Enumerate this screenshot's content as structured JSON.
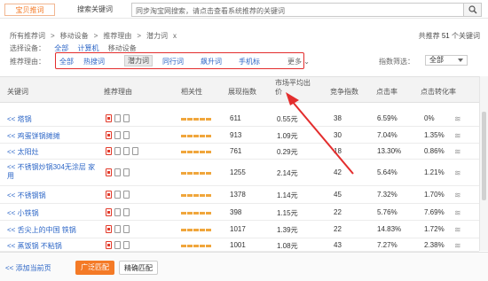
{
  "tabs": [
    {
      "label": "宝贝推词"
    },
    {
      "label": "搜索关键词"
    }
  ],
  "search": {
    "placeholder": "同步淘宝网搜索，请点击查看系统推荐的关键词"
  },
  "breadcrumb": {
    "a": "所有推荐词",
    "b": "移动设备",
    "c": "推荐理由",
    "d": "潜力词",
    "x": "x"
  },
  "count": {
    "prefix": "共推荐",
    "num": "51",
    "suffix": "个关键词"
  },
  "device": {
    "label": "选择设备：",
    "all": "全部",
    "pc": "计算机",
    "mobile": "移动设备"
  },
  "reason": {
    "label": "推荐理由：",
    "tags": [
      "全部",
      "热搜词",
      "潜力词",
      "同行词",
      "飙升词",
      "手机标"
    ],
    "more": "更多"
  },
  "filter": {
    "label": "指数筛选：",
    "value": "全部"
  },
  "columns": [
    "关键词",
    "推荐理由",
    "相关性",
    "展现指数",
    "市场平均出价",
    "竞争指数",
    "点击率",
    "点击转化率"
  ],
  "rows": [
    {
      "kw": "<< 塔锅",
      "show": "611",
      "price": "0.55元",
      "comp": "38",
      "ctr": "6.59%",
      "cvr": "0%"
    },
    {
      "kw": "<< 鸡蛋饼锅摊摊",
      "show": "913",
      "price": "1.09元",
      "comp": "30",
      "ctr": "7.04%",
      "cvr": "1.35%"
    },
    {
      "kw": "<< 太阳灶",
      "show": "761",
      "price": "0.29元",
      "comp": "18",
      "ctr": "13.30%",
      "cvr": "0.86%"
    },
    {
      "kw": "<< 不锈钢炒锅304无涂层 家用",
      "show": "1255",
      "price": "2.14元",
      "comp": "42",
      "ctr": "5.64%",
      "cvr": "1.21%"
    },
    {
      "kw": "<< 不锈钢锅",
      "show": "1378",
      "price": "1.14元",
      "comp": "45",
      "ctr": "7.32%",
      "cvr": "1.70%"
    },
    {
      "kw": "<< 小铁锅",
      "show": "398",
      "price": "1.15元",
      "comp": "22",
      "ctr": "5.76%",
      "cvr": "7.69%"
    },
    {
      "kw": "<< 舌尖上的中国 铁锅",
      "show": "1017",
      "price": "1.39元",
      "comp": "22",
      "ctr": "14.83%",
      "cvr": "1.72%"
    },
    {
      "kw": "<< 蒸饭锅 不粘锅",
      "show": "1001",
      "price": "1.08元",
      "comp": "43",
      "ctr": "7.27%",
      "cvr": "2.38%"
    }
  ],
  "bottom": {
    "add": "<< 添加当前页",
    "b1": "广泛匹配",
    "b2": "精确匹配"
  },
  "colors": {
    "accent": "#f47a26",
    "link": "#2e67c7",
    "highlight": "#e32d2d"
  }
}
